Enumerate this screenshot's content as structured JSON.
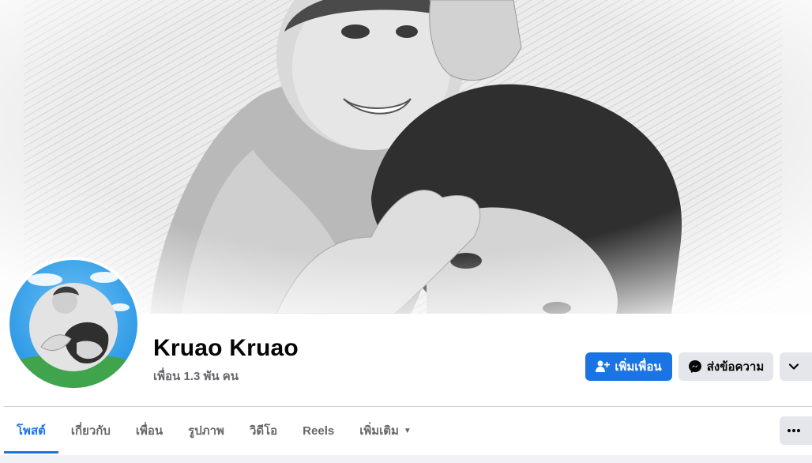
{
  "profile": {
    "name": "Kruao Kruao",
    "friends_count": "เพื่อน 1.3 พัน คน"
  },
  "actions": {
    "add_friend": "เพิ่มเพื่อน",
    "message": "ส่งข้อความ",
    "more_icon": "chevron-down-icon"
  },
  "tabs": [
    {
      "label": "โพสต์",
      "active": true
    },
    {
      "label": "เกี่ยวกับ",
      "active": false
    },
    {
      "label": "เพื่อน",
      "active": false
    },
    {
      "label": "รูปภาพ",
      "active": false
    },
    {
      "label": "วิดีโอ",
      "active": false
    },
    {
      "label": "Reels",
      "active": false
    },
    {
      "label": "เพิ่มเติม",
      "active": false
    }
  ],
  "tabs_more_icon": "ellipsis-icon",
  "colors": {
    "accent": "#1b74e4",
    "secondary_button": "#e4e6eb",
    "muted_text": "#65676b"
  }
}
